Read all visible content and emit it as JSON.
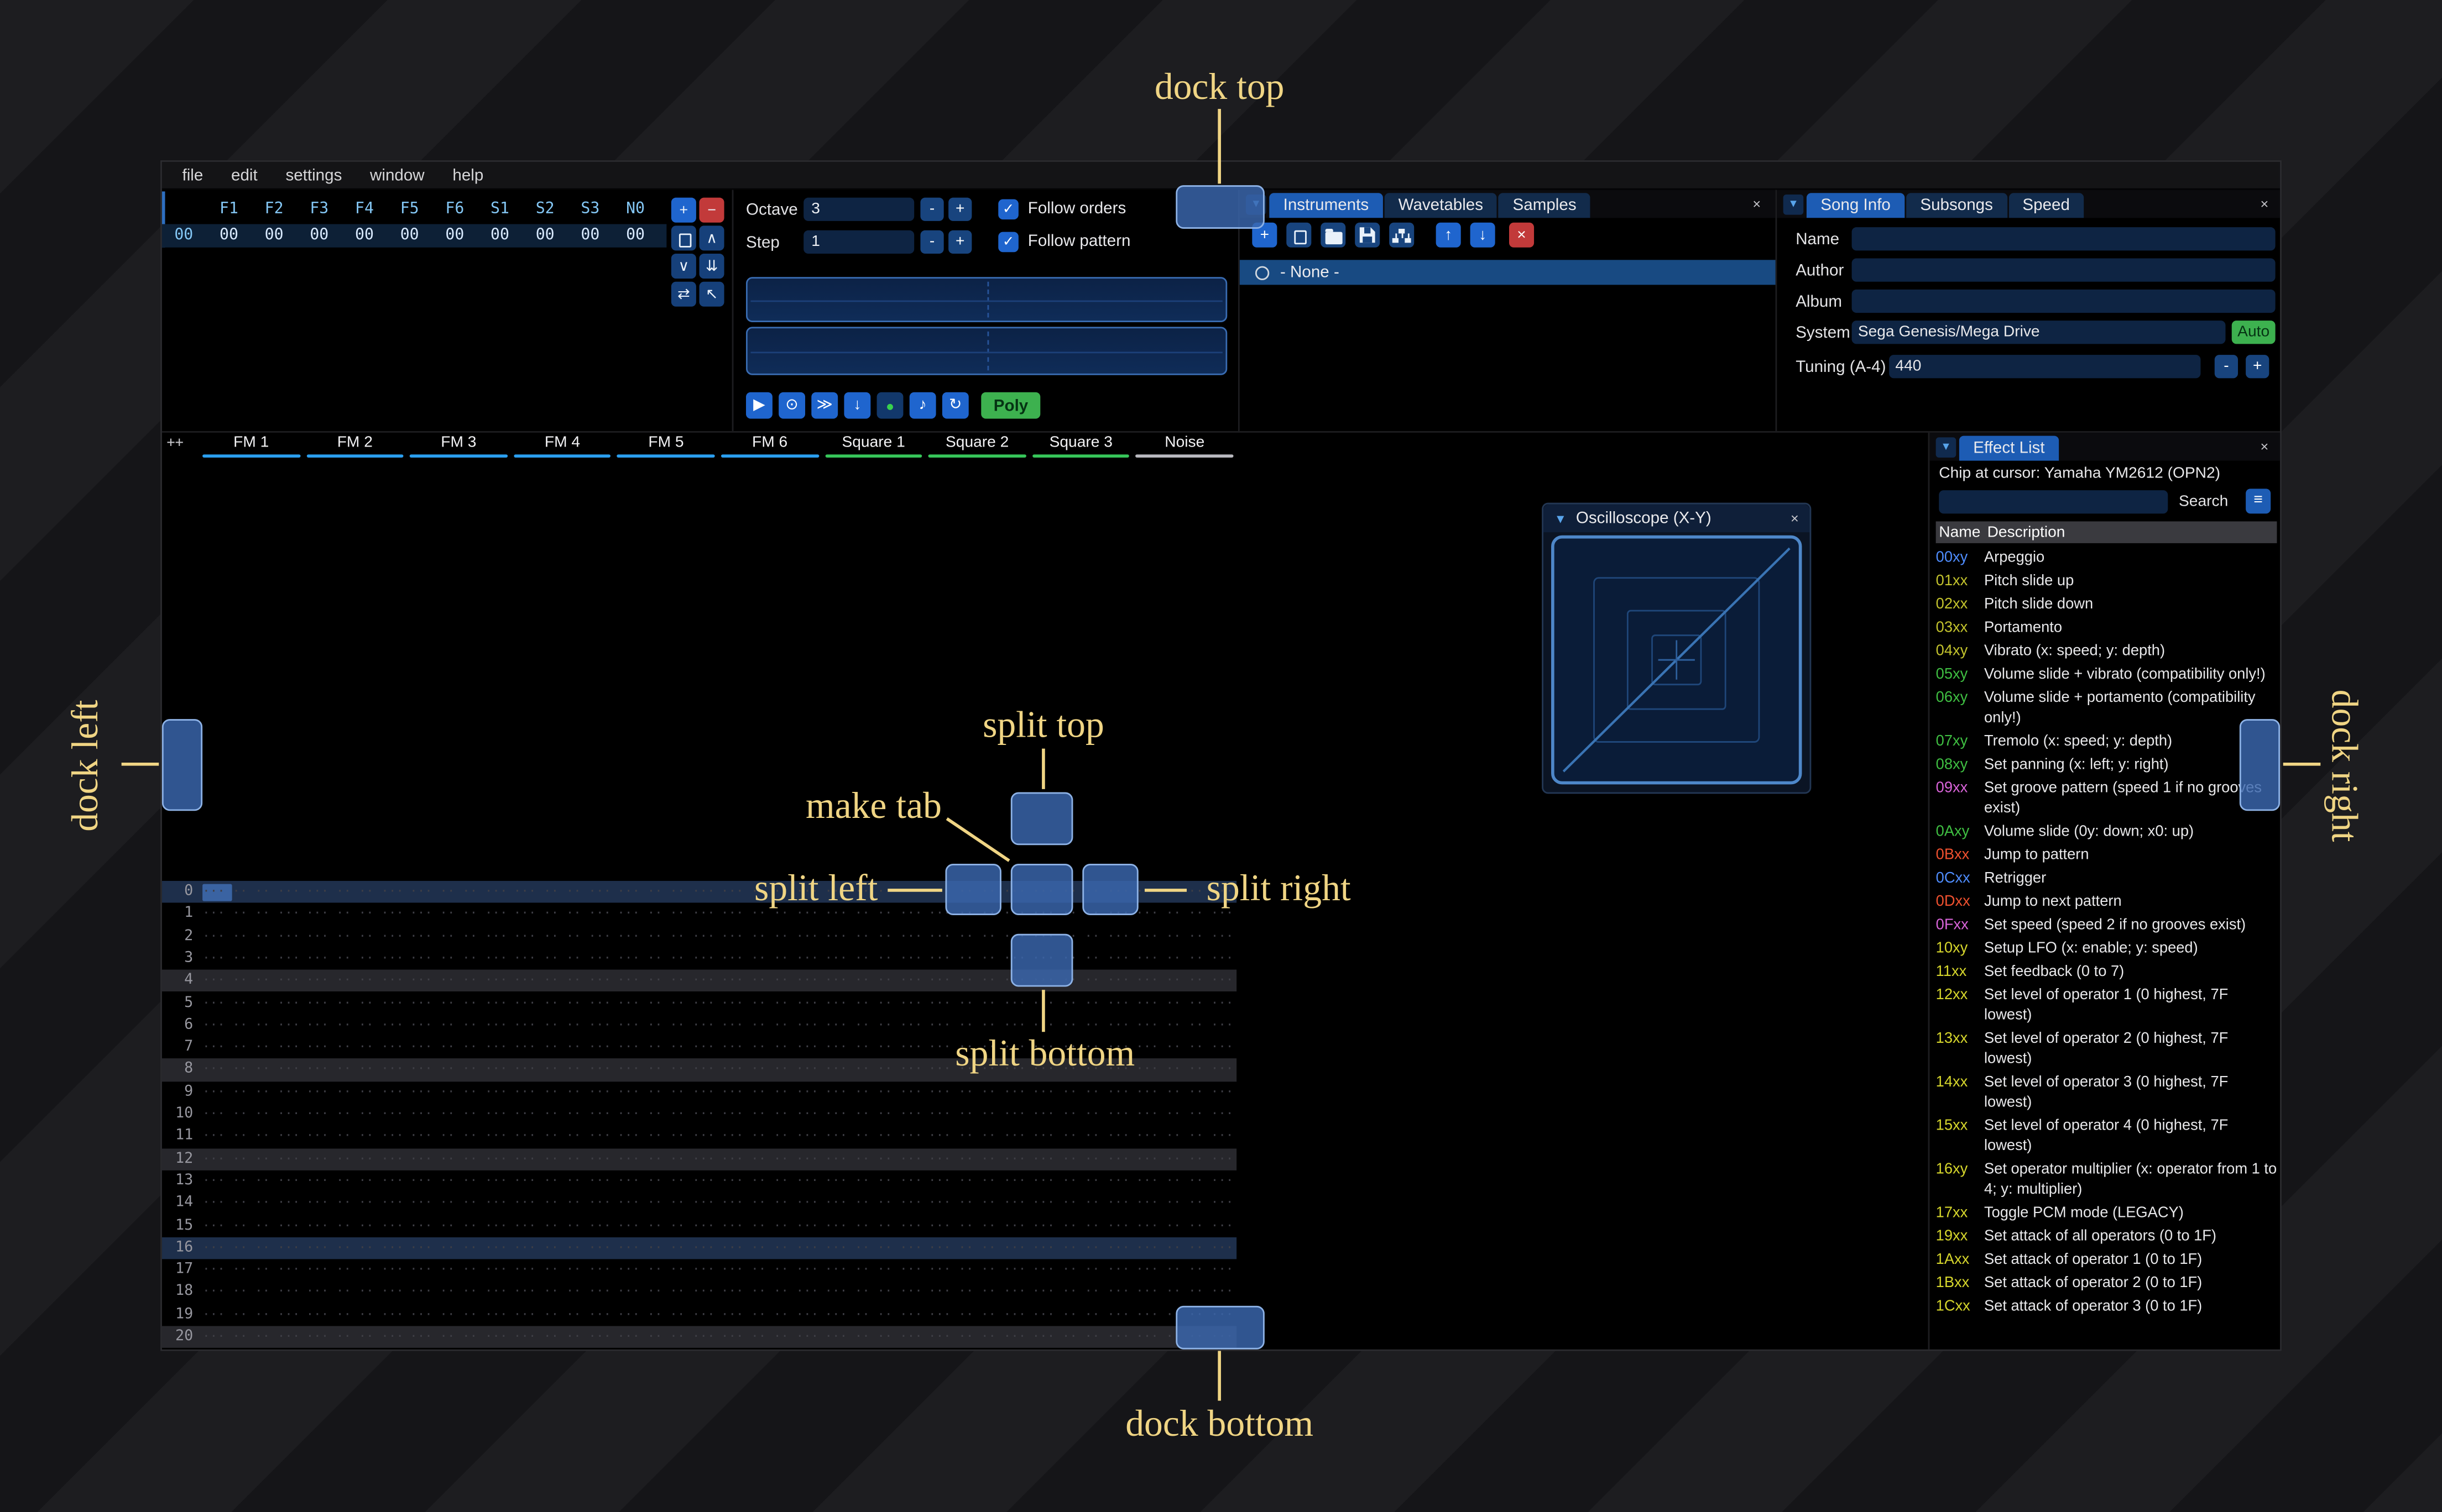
{
  "labels": {
    "dock_top": "dock top",
    "dock_bottom": "dock bottom",
    "dock_left": "dock left",
    "dock_right": "dock right",
    "split_top": "split top",
    "split_bottom": "split bottom",
    "split_left": "split left",
    "split_right": "split right",
    "make_tab": "make tab"
  },
  "icons": {
    "collapse": "▼",
    "close": "×",
    "menu": "≡",
    "check": "✓"
  },
  "menu": [
    "file",
    "edit",
    "settings",
    "window",
    "help"
  ],
  "orders": {
    "columns": [
      "F1",
      "F2",
      "F3",
      "F4",
      "F5",
      "F6",
      "S1",
      "S2",
      "S3",
      "N0"
    ],
    "row": {
      "index": "00",
      "values": [
        "00",
        "00",
        "00",
        "00",
        "00",
        "00",
        "00",
        "00",
        "00",
        "00"
      ]
    },
    "buttons": [
      {
        "name": "add-order",
        "glyph": "+",
        "style": "blue"
      },
      {
        "name": "remove-order",
        "glyph": "−",
        "style": "red"
      },
      {
        "name": "duplicate-order",
        "icon": "copy"
      },
      {
        "name": "move-order-up",
        "glyph": "∧"
      },
      {
        "name": "move-order-down",
        "glyph": "∨"
      },
      {
        "name": "clone-order-to-end",
        "glyph": "⇊"
      },
      {
        "name": "change-all-orders",
        "glyph": "⇄"
      },
      {
        "name": "order-edit-mode",
        "glyph": "↖"
      }
    ]
  },
  "controls": {
    "octave_label": "Octave",
    "octave_value": "3",
    "step_label": "Step",
    "step_value": "1",
    "minus": "-",
    "plus": "+",
    "follow_orders": "Follow orders",
    "follow_pattern": "Follow pattern",
    "poly": "Poly",
    "playback": [
      {
        "name": "play-button",
        "glyph": "▶"
      },
      {
        "name": "play-pattern-button",
        "glyph": "⊙"
      },
      {
        "name": "step-row-button",
        "glyph": "≫"
      },
      {
        "name": "stop-button",
        "glyph": "↓"
      },
      {
        "name": "record-button",
        "glyph": "●",
        "style": "record"
      },
      {
        "name": "metronome-button",
        "glyph": "♪"
      },
      {
        "name": "repeat-pattern-button",
        "glyph": "↻"
      }
    ]
  },
  "instruments": {
    "tabs": [
      "Instruments",
      "Wavetables",
      "Samples"
    ],
    "toolbar": [
      {
        "name": "add-instrument",
        "glyph": "+",
        "style": "accent"
      },
      {
        "name": "duplicate-instrument",
        "icon": "copy"
      },
      {
        "name": "open-instrument",
        "icon": "folder"
      },
      {
        "name": "save-instrument",
        "icon": "floppy"
      },
      {
        "name": "instrument-folders",
        "icon": "sitemap"
      },
      {
        "name": "move-instrument-up",
        "glyph": "↑",
        "style": "accent"
      },
      {
        "name": "move-instrument-down",
        "glyph": "↓",
        "style": "accent"
      },
      {
        "name": "delete-instrument",
        "glyph": "×",
        "style": "danger"
      }
    ],
    "list": [
      {
        "label": "- None -",
        "selected": true
      }
    ]
  },
  "song_info": {
    "tabs": [
      "Song Info",
      "Subsongs",
      "Speed"
    ],
    "fields": [
      {
        "label": "Name",
        "value": ""
      },
      {
        "label": "Author",
        "value": ""
      },
      {
        "label": "Album",
        "value": ""
      }
    ],
    "system_label": "System",
    "system_value": "Sega Genesis/Mega Drive",
    "auto": "Auto",
    "tuning_label": "Tuning (A-4)",
    "tuning_value": "440"
  },
  "pattern": {
    "corner": "++",
    "rows": 22,
    "hl_minor": [
      4,
      8,
      12,
      20
    ],
    "hl_major": [
      0,
      16
    ],
    "empty_cell": "··· ·· ·· ···",
    "channels": [
      {
        "name": "FM 1",
        "type": "fm"
      },
      {
        "name": "FM 2",
        "type": "fm"
      },
      {
        "name": "FM 3",
        "type": "fm"
      },
      {
        "name": "FM 4",
        "type": "fm"
      },
      {
        "name": "FM 5",
        "type": "fm"
      },
      {
        "name": "FM 6",
        "type": "fm"
      },
      {
        "name": "Square 1",
        "type": "square"
      },
      {
        "name": "Square 2",
        "type": "square"
      },
      {
        "name": "Square 3",
        "type": "square"
      },
      {
        "name": "Noise",
        "type": "noise"
      }
    ]
  },
  "oscilloscope": {
    "title": "Oscilloscope (X-Y)"
  },
  "effect_list": {
    "tab": "Effect List",
    "chip": "Chip at cursor: Yamaha YM2612 (OPN2)",
    "search_label": "Search",
    "search_value": "",
    "header_name": "Name",
    "header_desc": "Description",
    "effects": [
      {
        "code": "00xy",
        "color": "#4f8dff",
        "desc": "Arpeggio"
      },
      {
        "code": "01xx",
        "color": "#c3c32d",
        "desc": "Pitch slide up"
      },
      {
        "code": "02xx",
        "color": "#c3c32d",
        "desc": "Pitch slide down"
      },
      {
        "code": "03xx",
        "color": "#c3c32d",
        "desc": "Portamento"
      },
      {
        "code": "04xy",
        "color": "#c3c32d",
        "desc": "Vibrato (x: speed; y: depth)"
      },
      {
        "code": "05xy",
        "color": "#3fbf42",
        "desc": "Volume slide + vibrato (compatibility only!)"
      },
      {
        "code": "06xy",
        "color": "#3fbf42",
        "desc": "Volume slide + portamento (compatibility only!)"
      },
      {
        "code": "07xy",
        "color": "#3fbf42",
        "desc": "Tremolo (x: speed; y: depth)"
      },
      {
        "code": "08xy",
        "color": "#3fbf42",
        "desc": "Set panning (x: left; y: right)"
      },
      {
        "code": "09xx",
        "color": "#d964d9",
        "desc": "Set groove pattern (speed 1 if no grooves exist)"
      },
      {
        "code": "0Axy",
        "color": "#3fbf42",
        "desc": "Volume slide (0y: down; x0: up)"
      },
      {
        "code": "0Bxx",
        "color": "#f0512f",
        "desc": "Jump to pattern"
      },
      {
        "code": "0Cxx",
        "color": "#4f8dff",
        "desc": "Retrigger"
      },
      {
        "code": "0Dxx",
        "color": "#f0512f",
        "desc": "Jump to next pattern"
      },
      {
        "code": "0Fxx",
        "color": "#d964d9",
        "desc": "Set speed (speed 2 if no grooves exist)"
      },
      {
        "code": "10xy",
        "color": "#d6d62c",
        "desc": "Setup LFO (x: enable; y: speed)"
      },
      {
        "code": "11xx",
        "color": "#d6d62c",
        "desc": "Set feedback (0 to 7)"
      },
      {
        "code": "12xx",
        "color": "#d6d62c",
        "desc": "Set level of operator 1 (0 highest, 7F lowest)"
      },
      {
        "code": "13xx",
        "color": "#d6d62c",
        "desc": "Set level of operator 2 (0 highest, 7F lowest)"
      },
      {
        "code": "14xx",
        "color": "#d6d62c",
        "desc": "Set level of operator 3 (0 highest, 7F lowest)"
      },
      {
        "code": "15xx",
        "color": "#d6d62c",
        "desc": "Set level of operator 4 (0 highest, 7F lowest)"
      },
      {
        "code": "16xy",
        "color": "#d6d62c",
        "desc": "Set operator multiplier (x: operator from 1 to 4; y: multiplier)"
      },
      {
        "code": "17xx",
        "color": "#d6d62c",
        "desc": "Toggle PCM mode (LEGACY)"
      },
      {
        "code": "19xx",
        "color": "#d6d62c",
        "desc": "Set attack of all operators (0 to 1F)"
      },
      {
        "code": "1Axx",
        "color": "#d6d62c",
        "desc": "Set attack of operator 1 (0 to 1F)"
      },
      {
        "code": "1Bxx",
        "color": "#d6d62c",
        "desc": "Set attack of operator 2 (0 to 1F)"
      },
      {
        "code": "1Cxx",
        "color": "#d6d62c",
        "desc": "Set attack of operator 3 (0 to 1F)"
      }
    ]
  }
}
